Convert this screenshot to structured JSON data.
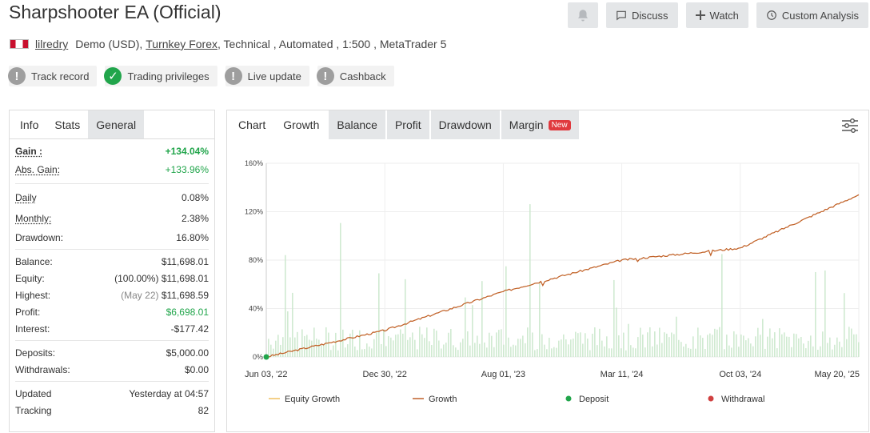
{
  "header": {
    "title": "Sharpshooter EA (Official)",
    "discuss_label": "Discuss",
    "watch_label": "Watch",
    "custom_analysis_label": "Custom Analysis"
  },
  "meta": {
    "user": "lilredry",
    "account_type": "Demo (USD),",
    "broker": "Turnkey Forex",
    "details": ", Technical , Automated , 1:500 , MetaTrader 5"
  },
  "badges": [
    {
      "label": "Track record",
      "status": "grey",
      "icon": "info-icon"
    },
    {
      "label": "Trading privileges",
      "status": "green",
      "icon": "check-icon"
    },
    {
      "label": "Live update",
      "status": "grey",
      "icon": "info-icon"
    },
    {
      "label": "Cashback",
      "status": "grey",
      "icon": "info-icon"
    }
  ],
  "left_tabs": [
    "Info",
    "Stats",
    "General"
  ],
  "stats": {
    "gain_label": "Gain :",
    "gain_value": "+134.04%",
    "abs_gain_label": "Abs. Gain:",
    "abs_gain_value": "+133.96%",
    "daily_label": "Daily",
    "daily_value": "0.08%",
    "monthly_label": "Monthly:",
    "monthly_value": "2.38%",
    "drawdown_label": "Drawdown:",
    "drawdown_value": "16.80%",
    "balance_label": "Balance:",
    "balance_value": "$11,698.01",
    "equity_label": "Equity:",
    "equity_pct": "(100.00%)",
    "equity_value": "$11,698.01",
    "highest_label": "Highest:",
    "highest_date": "(May 22)",
    "highest_value": "$11,698.59",
    "profit_label": "Profit:",
    "profit_value": "$6,698.01",
    "interest_label": "Interest:",
    "interest_value": "-$177.42",
    "deposits_label": "Deposits:",
    "deposits_value": "$5,000.00",
    "withdrawals_label": "Withdrawals:",
    "withdrawals_value": "$0.00",
    "updated_label": "Updated",
    "updated_value": "Yesterday at 04:57",
    "tracking_label": "Tracking",
    "tracking_value": "82"
  },
  "chart_tabs": [
    "Chart",
    "Growth",
    "Balance",
    "Profit",
    "Drawdown",
    "Margin"
  ],
  "new_badge": "New",
  "colors": {
    "growth": "#c0602a",
    "equity_growth": "#f0c060",
    "deposit": "#21a54b",
    "withdrawal": "#d04040",
    "volume_bars": "#c8e6c9",
    "accent_green": "#21a54b"
  },
  "chart_data": {
    "type": "line",
    "x_tick_labels": [
      "Jun 03, '22",
      "Dec 30, '22",
      "Aug 01, '23",
      "Mar 11, '24",
      "Oct 03, '24",
      "May 20, '25"
    ],
    "y_tick_labels": [
      "0%",
      "40%",
      "80%",
      "120%",
      "160%"
    ],
    "ylim": [
      0,
      160
    ],
    "grid": true,
    "legend_position": "bottom",
    "series": [
      {
        "name": "Growth",
        "values_by_tick": [
          0,
          22,
          54,
          80,
          90,
          134
        ]
      },
      {
        "name": "Equity Growth",
        "values_by_tick": [
          0,
          22,
          54,
          80,
          90,
          134
        ]
      }
    ],
    "deposit_points": [
      [
        0,
        0
      ]
    ],
    "legend": [
      "Equity Growth",
      "Growth",
      "Deposit",
      "Withdrawal"
    ]
  }
}
